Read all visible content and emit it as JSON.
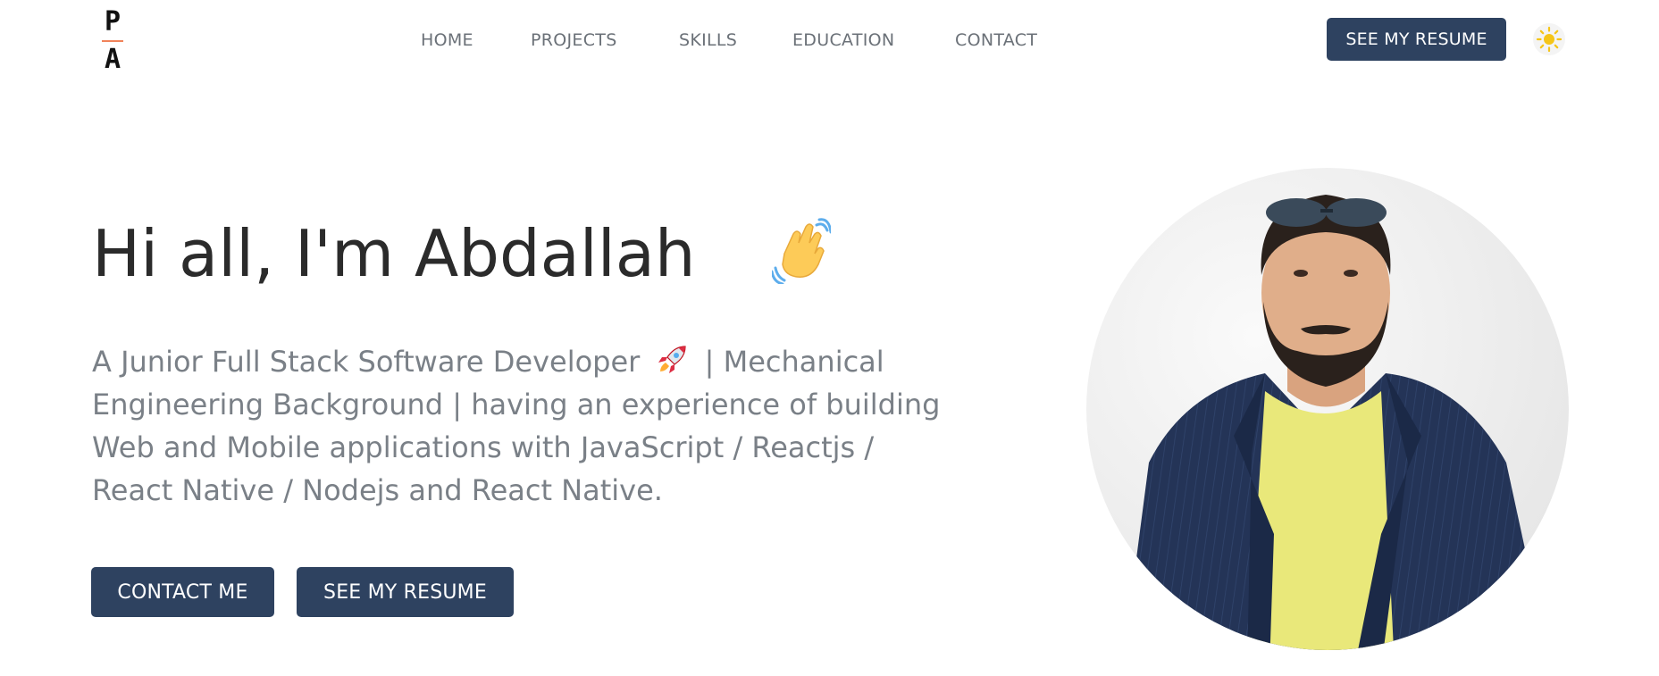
{
  "header": {
    "logo": {
      "top": "P",
      "bottom": "A"
    },
    "nav": [
      "HOME",
      "PROJECTS",
      "SKILLS",
      "EDUCATION",
      "CONTACT"
    ],
    "resume_button": "SEE MY RESUME",
    "theme_icon": "sun-icon"
  },
  "hero": {
    "greeting": "Hi all, I'm Abdallah",
    "greeting_icon": "waving-hand-icon",
    "description_part1": "A Junior Full Stack Software Developer",
    "description_icon": "rocket-icon",
    "description_part2": "| Mechanical Engineering Background | having an experience of building Web and Mobile applications with JavaScript / Reactjs / React Native / Nodejs and React Native.",
    "contact_button": "CONTACT ME",
    "resume_button": "SEE MY RESUME"
  },
  "colors": {
    "accent": "#2e4260",
    "nav_text": "#6b7178",
    "heading": "#2b2b2b",
    "body_text": "#7a8087",
    "logo_bar": "#f0835a"
  }
}
